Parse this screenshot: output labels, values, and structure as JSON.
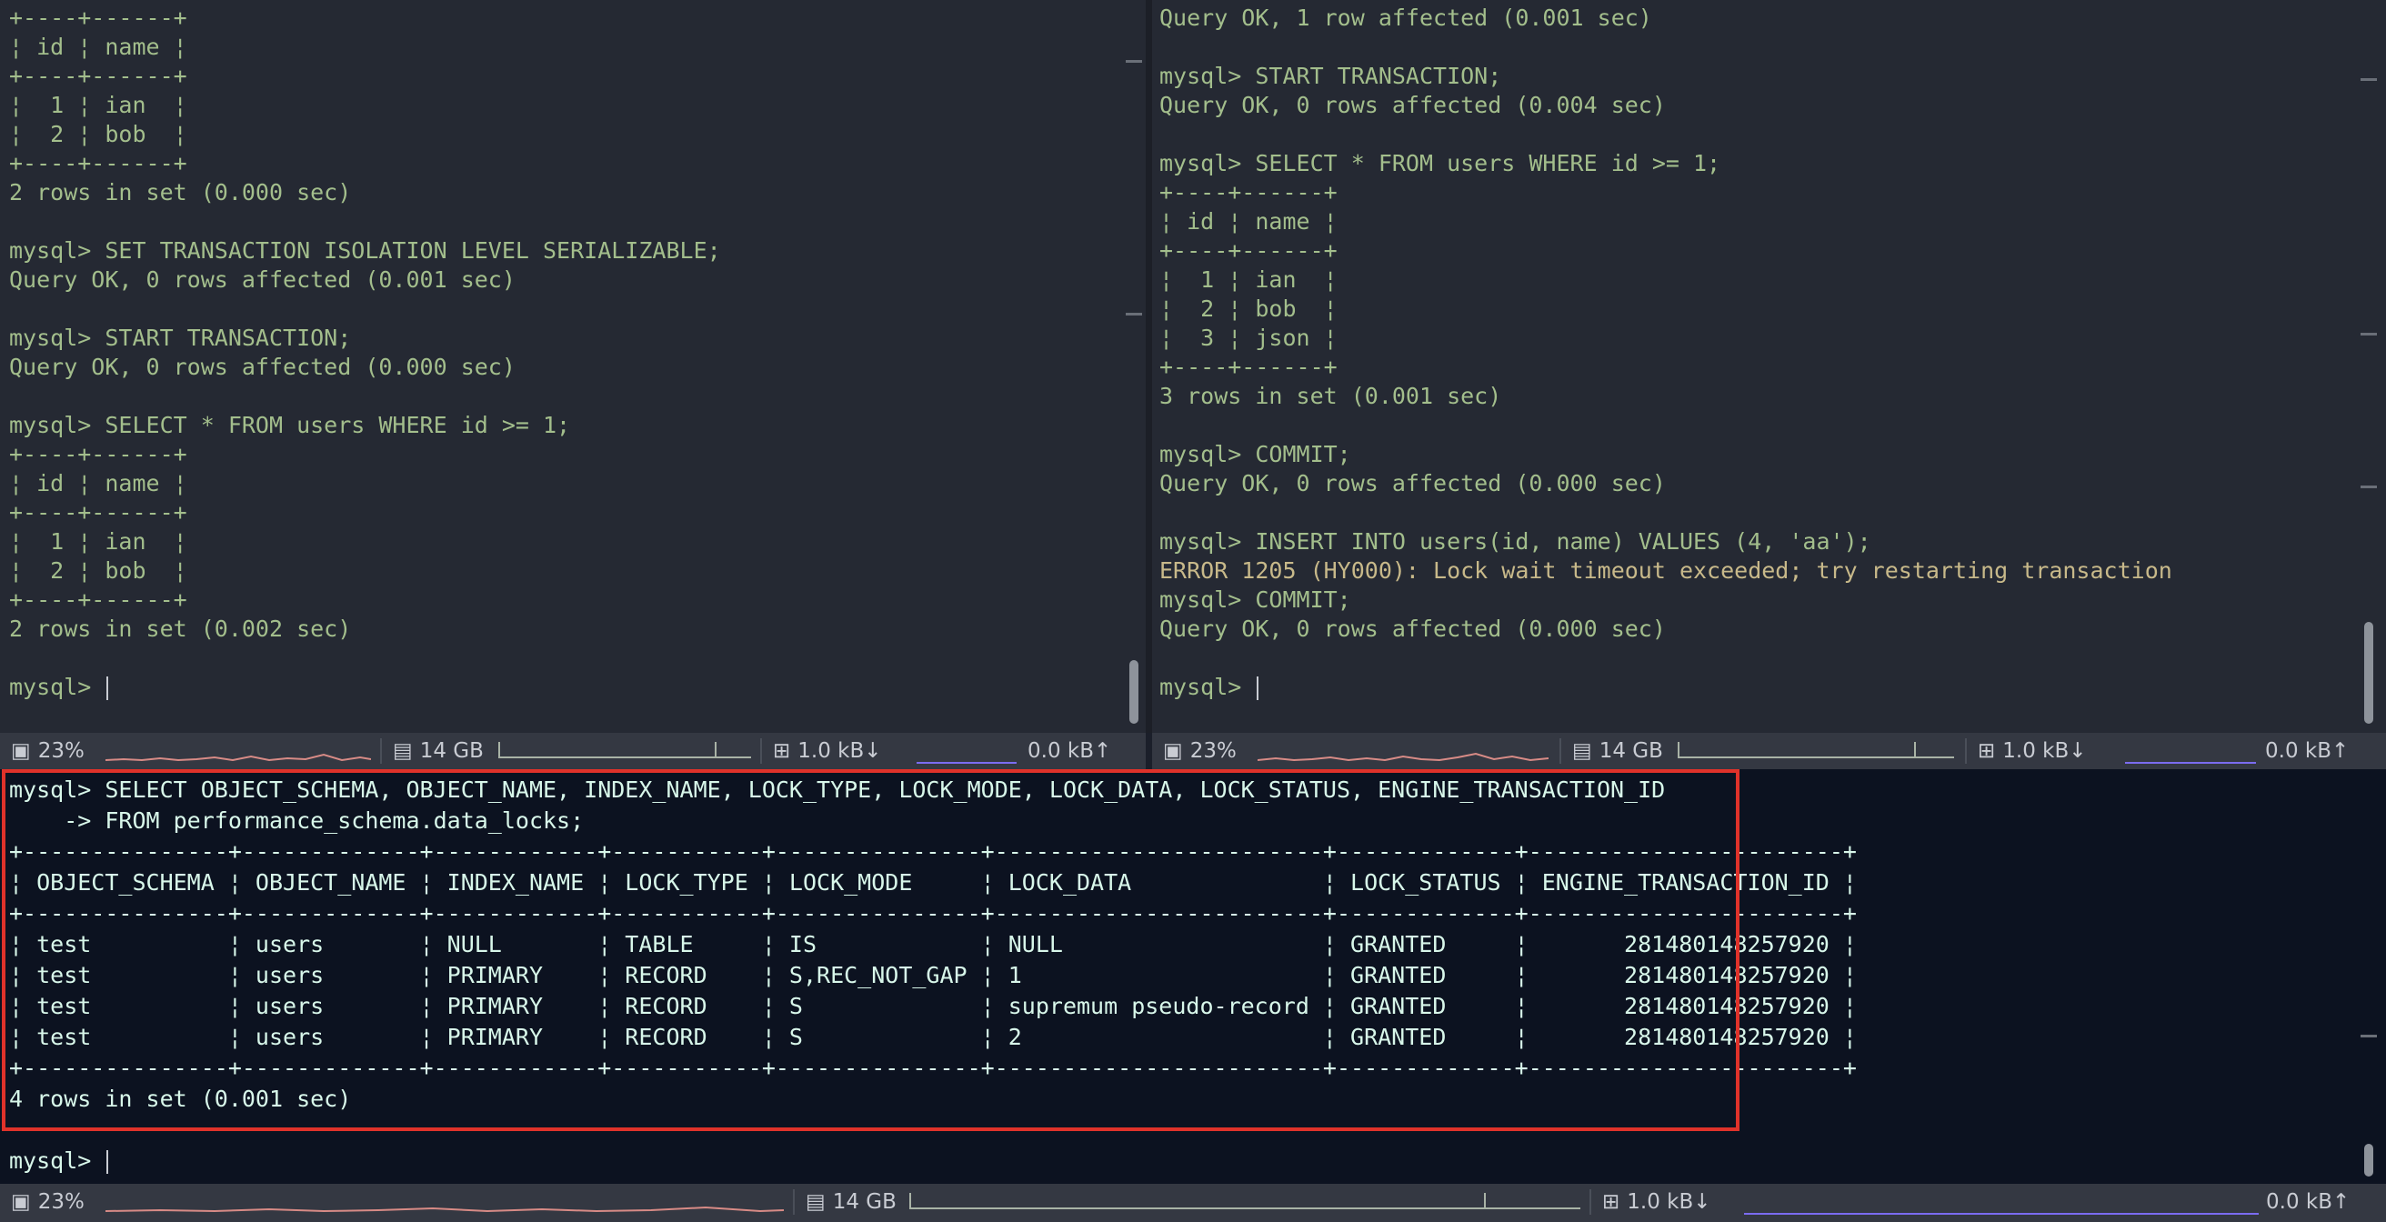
{
  "panes": {
    "top_left": {
      "lines": [
        "+----+------+",
        "¦ id ¦ name ¦",
        "+----+------+",
        "¦  1 ¦ ian  ¦",
        "¦  2 ¦ bob  ¦",
        "+----+------+",
        "2 rows in set (0.000 sec)",
        "",
        "mysql> SET TRANSACTION ISOLATION LEVEL SERIALIZABLE;",
        "Query OK, 0 rows affected (0.001 sec)",
        "",
        "mysql> START TRANSACTION;",
        "Query OK, 0 rows affected (0.000 sec)",
        "",
        "mysql> SELECT * FROM users WHERE id >= 1;",
        "+----+------+",
        "¦ id ¦ name ¦",
        "+----+------+",
        "¦  1 ¦ ian  ¦",
        "¦  2 ¦ bob  ¦",
        "+----+------+",
        "2 rows in set (0.002 sec)",
        ""
      ],
      "prompt": "mysql> "
    },
    "top_right": {
      "lines": [
        "Query OK, 1 row affected (0.001 sec)",
        "",
        "mysql> START TRANSACTION;",
        "Query OK, 0 rows affected (0.004 sec)",
        "",
        "mysql> SELECT * FROM users WHERE id >= 1;",
        "+----+------+",
        "¦ id ¦ name ¦",
        "+----+------+",
        "¦  1 ¦ ian  ¦",
        "¦  2 ¦ bob  ¦",
        "¦  3 ¦ json ¦",
        "+----+------+",
        "3 rows in set (0.001 sec)",
        "",
        "mysql> COMMIT;",
        "Query OK, 0 rows affected (0.000 sec)",
        "",
        "mysql> INSERT INTO users(id, name) VALUES (4, 'aa');",
        "ERROR 1205 (HY000): Lock wait timeout exceeded; try restarting transaction",
        "mysql> COMMIT;",
        "Query OK, 0 rows affected (0.000 sec)",
        ""
      ],
      "prompt": "mysql> "
    },
    "bottom": {
      "lines": [
        "mysql> SELECT OBJECT_SCHEMA, OBJECT_NAME, INDEX_NAME, LOCK_TYPE, LOCK_MODE, LOCK_DATA, LOCK_STATUS, ENGINE_TRANSACTION_ID",
        "    -> FROM performance_schema.data_locks;",
        "+---------------+-------------+------------+-----------+---------------+------------------------+-------------+-----------------------+",
        "¦ OBJECT_SCHEMA ¦ OBJECT_NAME ¦ INDEX_NAME ¦ LOCK_TYPE ¦ LOCK_MODE     ¦ LOCK_DATA              ¦ LOCK_STATUS ¦ ENGINE_TRANSACTION_ID ¦",
        "+---------------+-------------+------------+-----------+---------------+------------------------+-------------+-----------------------+",
        "¦ test          ¦ users       ¦ NULL       ¦ TABLE     ¦ IS            ¦ NULL                   ¦ GRANTED     ¦       281480148257920 ¦",
        "¦ test          ¦ users       ¦ PRIMARY    ¦ RECORD    ¦ S,REC_NOT_GAP ¦ 1                      ¦ GRANTED     ¦       281480148257920 ¦",
        "¦ test          ¦ users       ¦ PRIMARY    ¦ RECORD    ¦ S             ¦ supremum pseudo-record ¦ GRANTED     ¦       281480148257920 ¦",
        "¦ test          ¦ users       ¦ PRIMARY    ¦ RECORD    ¦ S             ¦ 2                      ¦ GRANTED     ¦       281480148257920 ¦",
        "+---------------+-------------+------------+-----------+---------------+------------------------+-------------+-----------------------+",
        "4 rows in set (0.001 sec)",
        ""
      ],
      "prompt": "mysql> "
    }
  },
  "status": {
    "cpu": "23%",
    "mem": "14 GB",
    "net_down": "1.0 kB↓",
    "net_up": "0.0 kB↑"
  },
  "icons": [
    "cpu-icon",
    "memory-icon",
    "network-icon"
  ],
  "colors": {
    "prompt_text": "#a3be8c",
    "bottom_text": "#d8f7ea",
    "highlight_border": "#e0322a",
    "status_bg": "#343842"
  }
}
